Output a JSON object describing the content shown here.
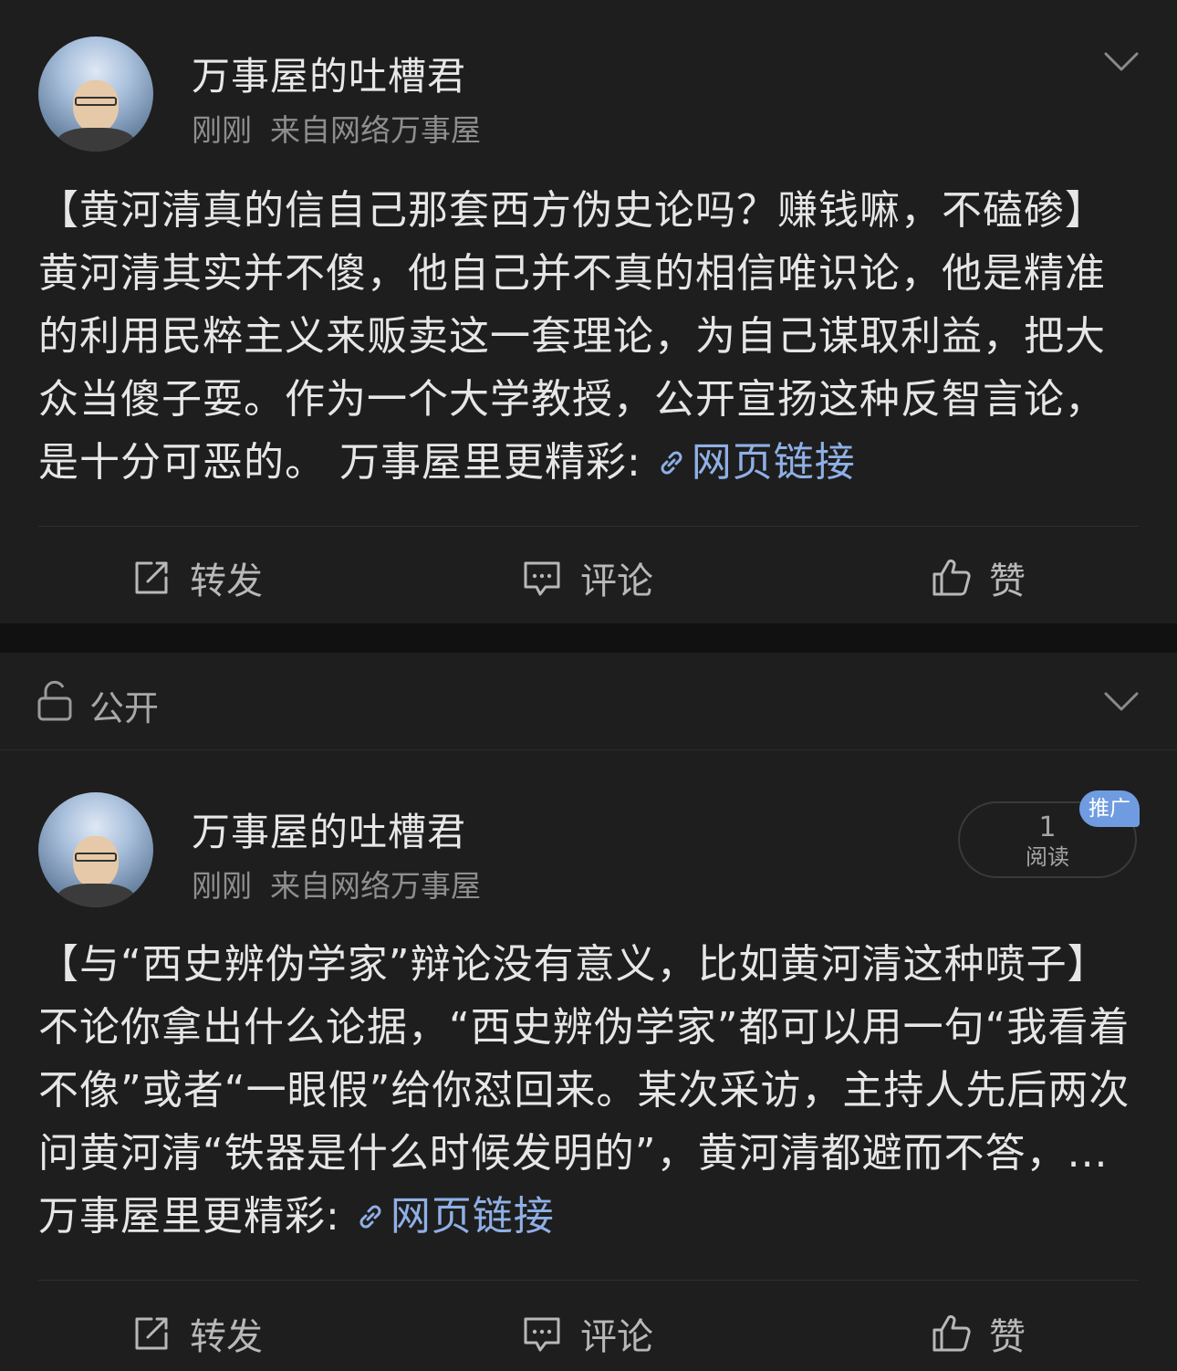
{
  "post1": {
    "author": "万事屋的吐槽君",
    "time": "刚刚",
    "source": "来自网络万事屋",
    "text": "【黄河清真的信自己那套西方伪史论吗？赚钱嘛，不磕碜】黄河清其实并不傻，他自己并不真的相信唯识论，他是精准的利用民粹主义来贩卖这一套理论，为自己谋取利益，把大众当傻子耍。作为一个大学教授，公开宣扬这种反智言论，是十分可恶的。 万事屋里更精彩: ",
    "link_text": "网页链接",
    "actions": {
      "repost": "转发",
      "comment": "评论",
      "like": "赞"
    }
  },
  "visibility": {
    "label": "公开"
  },
  "post2": {
    "author": "万事屋的吐槽君",
    "time": "刚刚",
    "source": "来自网络万事屋",
    "read_count": "1",
    "read_label": "阅读",
    "promo_label": "推广",
    "text": "【与“西史辨伪学家”辩论没有意义，比如黄河清这种喷子】不论你拿出什么论据，“西史辨伪学家”都可以用一句“我看着不像”或者“一眼假”给你怼回来。某次采访，主持人先后两次问黄河清“铁器是什么时候发明的”，黄河清都避而不答，... 万事屋里更精彩: ",
    "link_text": "网页链接",
    "actions": {
      "repost": "转发",
      "comment": "评论",
      "like": "赞"
    }
  },
  "icons": {
    "chevron": "chevron-down-icon",
    "link": "link-icon",
    "repost": "repost-icon",
    "comment": "comment-icon",
    "like": "thumbs-up-icon",
    "lock": "unlock-icon"
  },
  "colors": {
    "background": "#111111",
    "card": "#1e1e1e",
    "link": "#8fb0e6",
    "promo": "#6f9ce0"
  }
}
